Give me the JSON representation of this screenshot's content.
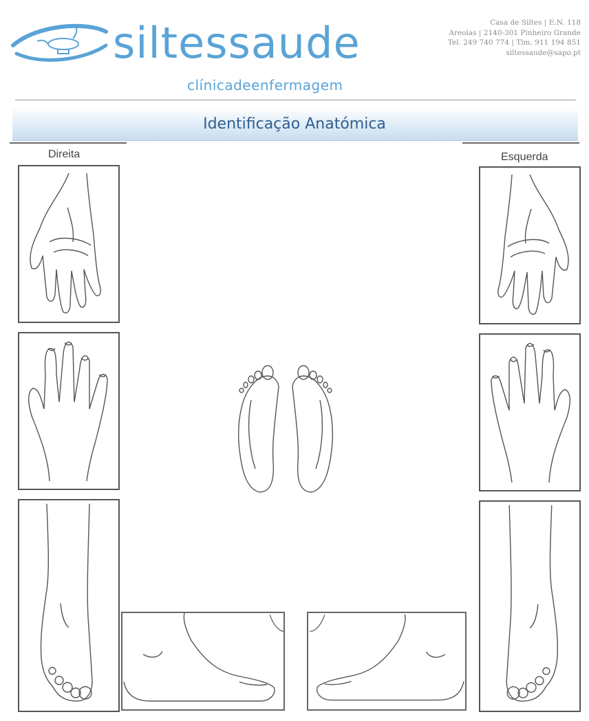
{
  "header": {
    "brand": "siltessaude",
    "subtitle": "clínicadeenfermagem",
    "contact": [
      "Casa de Siltes | E.N. 118",
      "Areolas | 2140-301 Pinheiro Grande",
      "Tel. 249 740 774 | Tlm. 911 194 851",
      "siltessaude@sapo.pt"
    ]
  },
  "banner": {
    "title": "Identificação Anatómica"
  },
  "labels": {
    "right": "Direita",
    "left": "Esquerda"
  },
  "colors": {
    "brand": "#5aa3d6",
    "title": "#2f5f8f",
    "banner": "#dceaf6"
  }
}
